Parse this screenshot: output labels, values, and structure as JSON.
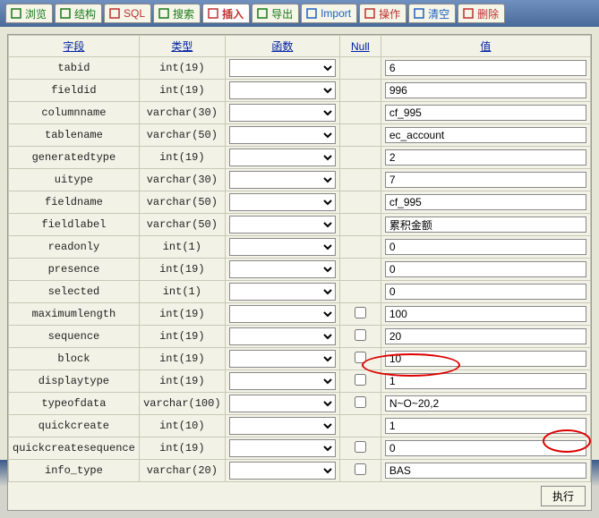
{
  "tabs": [
    {
      "name": "browse",
      "label": "浏览",
      "color": "#1a7a1a"
    },
    {
      "name": "structure",
      "label": "结构",
      "color": "#1a7a1a"
    },
    {
      "name": "sql",
      "label": "SQL",
      "color": "#c03030"
    },
    {
      "name": "search",
      "label": "搜索",
      "color": "#1a7a1a"
    },
    {
      "name": "insert",
      "label": "插入",
      "color": "#c03030"
    },
    {
      "name": "export",
      "label": "导出",
      "color": "#1a7a1a"
    },
    {
      "name": "import",
      "label": "Import",
      "color": "#2060c0"
    },
    {
      "name": "operations",
      "label": "操作",
      "color": "#c03030"
    },
    {
      "name": "empty",
      "label": "清空",
      "color": "#2060c0"
    },
    {
      "name": "drop",
      "label": "删除",
      "color": "#c03030"
    }
  ],
  "active_tab": 4,
  "headers": {
    "field": "字段",
    "type": "类型",
    "function": "函数",
    "null": "Null",
    "value": "值"
  },
  "rows": [
    {
      "field": "tabid",
      "type": "int(19)",
      "null_cb": false,
      "value": "6"
    },
    {
      "field": "fieldid",
      "type": "int(19)",
      "null_cb": false,
      "value": "996"
    },
    {
      "field": "columnname",
      "type": "varchar(30)",
      "null_cb": false,
      "value": "cf_995"
    },
    {
      "field": "tablename",
      "type": "varchar(50)",
      "null_cb": false,
      "value": "ec_account"
    },
    {
      "field": "generatedtype",
      "type": "int(19)",
      "null_cb": false,
      "value": "2"
    },
    {
      "field": "uitype",
      "type": "varchar(30)",
      "null_cb": false,
      "value": "7"
    },
    {
      "field": "fieldname",
      "type": "varchar(50)",
      "null_cb": false,
      "value": "cf_995"
    },
    {
      "field": "fieldlabel",
      "type": "varchar(50)",
      "null_cb": false,
      "value": "累积金额"
    },
    {
      "field": "readonly",
      "type": "int(1)",
      "null_cb": false,
      "value": "0"
    },
    {
      "field": "presence",
      "type": "int(19)",
      "null_cb": false,
      "value": "0"
    },
    {
      "field": "selected",
      "type": "int(1)",
      "null_cb": false,
      "value": "0"
    },
    {
      "field": "maximumlength",
      "type": "int(19)",
      "null_cb": true,
      "value": "100"
    },
    {
      "field": "sequence",
      "type": "int(19)",
      "null_cb": true,
      "value": "20"
    },
    {
      "field": "block",
      "type": "int(19)",
      "null_cb": true,
      "value": "10"
    },
    {
      "field": "displaytype",
      "type": "int(19)",
      "null_cb": true,
      "value": "1"
    },
    {
      "field": "typeofdata",
      "type": "varchar(100)",
      "null_cb": true,
      "value": "N~O~20,2"
    },
    {
      "field": "quickcreate",
      "type": "int(10)",
      "null_cb": false,
      "value": "1"
    },
    {
      "field": "quickcreatesequence",
      "type": "int(19)",
      "null_cb": true,
      "value": "0"
    },
    {
      "field": "info_type",
      "type": "varchar(20)",
      "null_cb": true,
      "value": "BAS"
    }
  ],
  "execute_label": "执行"
}
